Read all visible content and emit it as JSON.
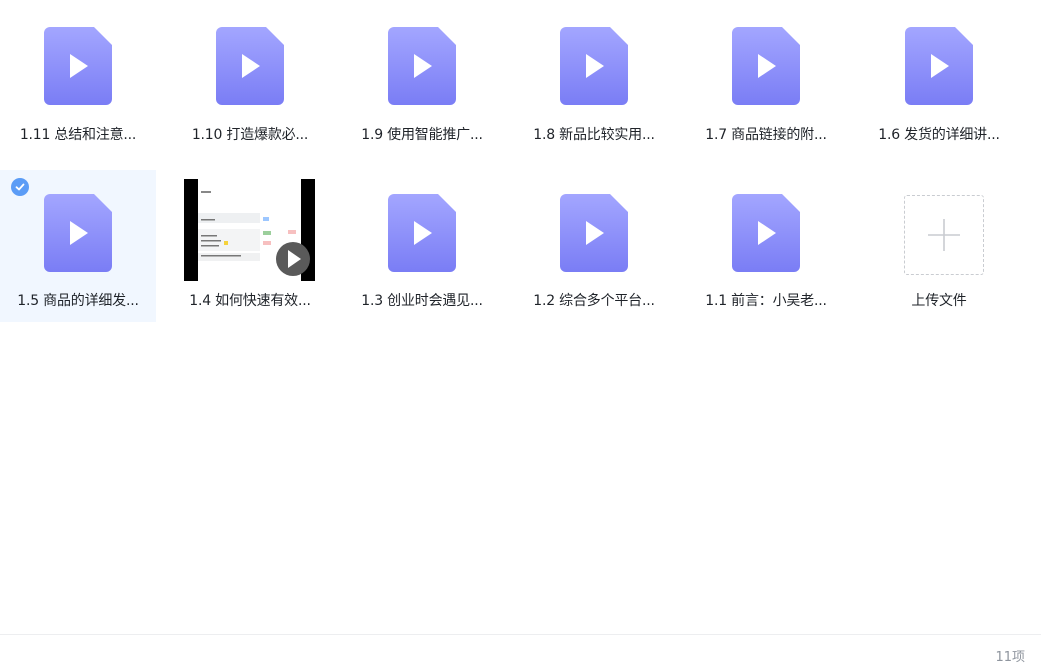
{
  "files_row1": [
    {
      "name": "1.11 总结和注意..."
    },
    {
      "name": "1.10 打造爆款必..."
    },
    {
      "name": "1.9 使用智能推广..."
    },
    {
      "name": "1.8 新品比较实用..."
    },
    {
      "name": "1.7 商品链接的附..."
    },
    {
      "name": "1.6 发货的详细讲..."
    }
  ],
  "files_row2": [
    {
      "name": "1.5 商品的详细发...",
      "selected": true
    },
    {
      "name": "1.4 如何快速有效...",
      "has_thumbnail": true
    },
    {
      "name": "1.3 创业时会遇见..."
    },
    {
      "name": "1.2 综合多个平台..."
    },
    {
      "name": "1.1 前言：小吴老..."
    }
  ],
  "upload": {
    "label": "上传文件"
  },
  "footer": {
    "count": "11项"
  },
  "colors": {
    "icon_gradient_top": "#a3a6ff",
    "icon_gradient_bottom": "#7a7df5",
    "selected_bg": "#f1f7ff",
    "check": "#5b9cf6"
  },
  "icons": {
    "video_file": "video-file-icon",
    "play": "play-icon",
    "check": "check-icon",
    "plus": "plus-icon"
  }
}
